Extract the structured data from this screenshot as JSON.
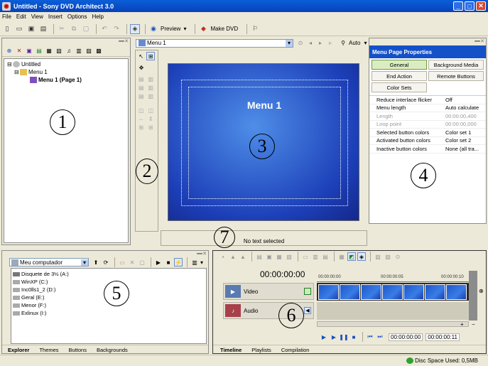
{
  "window": {
    "title": "Untitled - Sony DVD Architect 3.0",
    "min": "_",
    "max": "□",
    "close": "✕"
  },
  "menu": [
    "File",
    "Edit",
    "View",
    "Insert",
    "Options",
    "Help"
  ],
  "toolbar": {
    "preview_label": "Preview",
    "make_dvd_label": "Make DVD"
  },
  "project_tree": {
    "root": "Untitled",
    "menu": "Menu 1",
    "page": "Menu 1 (Page 1)"
  },
  "preview": {
    "selected_menu": "Menu 1",
    "zoom": "Auto",
    "menu_title": "Menu 1",
    "status": "No text selected"
  },
  "properties": {
    "title": "Menu Page Properties",
    "tabs": [
      "General",
      "Background Media",
      "End Action",
      "Remote Buttons",
      "Color Sets"
    ],
    "selected_tab": "General",
    "rows": [
      {
        "name": "Reduce interlace flicker",
        "value": "Off",
        "disabled": false
      },
      {
        "name": "Menu length",
        "value": "Auto calculate",
        "disabled": false
      },
      {
        "name": "Length",
        "value": "00:00:00,400",
        "disabled": true
      },
      {
        "name": "Loop point",
        "value": "00:00:00,000",
        "disabled": true
      },
      {
        "name": "Selected button colors",
        "value": "Color set 1",
        "disabled": false
      },
      {
        "name": "Activated button colors",
        "value": "Color set 2",
        "disabled": false
      },
      {
        "name": "Inactive button colors",
        "value": "None (all tra...",
        "disabled": false
      }
    ]
  },
  "explorer": {
    "location": "Meu computador",
    "items": [
      "Disquete de 3½ (A:)",
      "WinXP (C:)",
      "Inc0lls1_2 (D:)",
      "Geral (E:)",
      "Menor (F:)",
      "Exlinux (I:)"
    ],
    "tabs": [
      "Explorer",
      "Themes",
      "Buttons",
      "Backgrounds"
    ],
    "active_tab": "Explorer"
  },
  "timeline": {
    "timecode": "00:00:00:00",
    "ruler": [
      "00:00:00:00",
      "00:00:00:05",
      "00:00:00:10"
    ],
    "tracks": [
      "Video",
      "Audio"
    ],
    "transport_start": "00:00:00:00",
    "transport_end": "00:00:00:11",
    "tabs": [
      "Timeline",
      "Playlists",
      "Compilation"
    ],
    "active_tab": "Timeline"
  },
  "annotations": [
    "1",
    "2",
    "3",
    "4",
    "5",
    "6",
    "7"
  ],
  "statusbar": {
    "disc_space": "Disc Space Used: 0,5MB"
  },
  "colors": {
    "titlebar": "#0842b8",
    "menu_bg": "#1c3fb8",
    "prop_header": "#1450c8"
  }
}
